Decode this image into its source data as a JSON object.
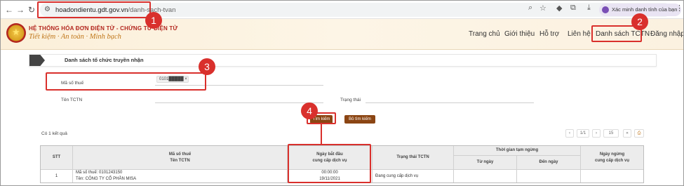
{
  "browser": {
    "url_host": "hoadondientu.gdt.gov.vn",
    "url_path": "/danh-sach-tvan",
    "profile_label": "Xác minh danh tính của bạn"
  },
  "site": {
    "brand_line1": "HỆ THỐNG HÓA ĐƠN ĐIỆN TỬ - CHỨNG TỪ ĐIỆN TỬ",
    "brand_line2": "Tiết kiệm · An toàn · Minh bạch",
    "menu": [
      "Trang chủ",
      "Giới thiệu",
      "Hỗ trợ",
      "Liên hệ",
      "Danh sách TCTN",
      "Đăng nhập"
    ]
  },
  "panel": {
    "title": "Danh sách tổ chức truyền nhận",
    "mst_label": "Mã số thuế",
    "mst_chip": "0101█████ ×",
    "tctn_label": "Tên TCTN",
    "status_label": "Trạng thái",
    "search_btn": "Tìm kiếm",
    "clear_btn": "Bỏ tìm kiếm",
    "result_count": "Có 1 kết quả",
    "page_info": "1/1",
    "page_size": "15"
  },
  "table": {
    "headers": {
      "stt": "STT",
      "mst_ten": "Mã số thuế\nTên TCTN",
      "start_date": "Ngày bắt đầu\ncung cấp dịch vụ",
      "status": "Trạng thái TCTN",
      "pause_group": "Thời gian tạm ngừng",
      "from": "Từ ngày",
      "to": "Đến ngày",
      "stop": "Ngày ngừng\ncung cấp dịch vụ"
    },
    "rows": [
      {
        "stt": "1",
        "mst": "Mã số thuế: 0101243150",
        "name": "Tên: CÔNG TY CỔ PHẦN MISA",
        "time": "00:00:00",
        "date": "19/11/2021",
        "status": "Đang cung cấp dịch vụ",
        "from": "",
        "to": "",
        "stop": ""
      }
    ]
  },
  "annotations": [
    "1",
    "2",
    "3",
    "4"
  ],
  "colors": {
    "highlight": "#d9302c",
    "button": "#8b4513"
  }
}
